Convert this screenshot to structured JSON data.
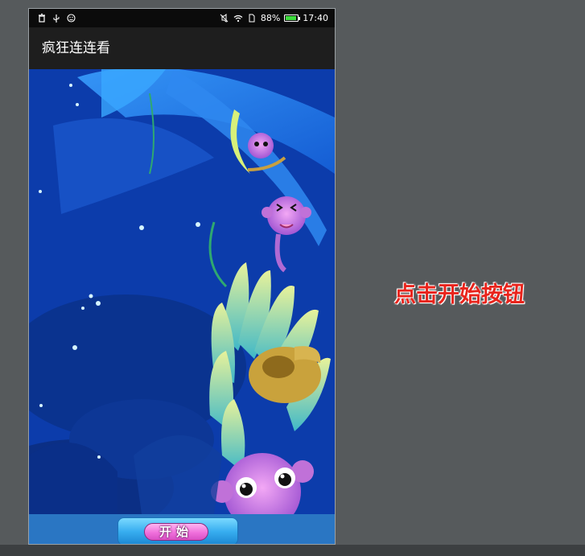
{
  "status_bar": {
    "left_icons": [
      "trash-icon",
      "usb-icon",
      "face-icon"
    ],
    "battery_percent": "88%",
    "time": "17:40",
    "battery_fill_fraction": 0.88
  },
  "app_bar": {
    "title": "疯狂连连看"
  },
  "footer": {
    "start_label": "开始"
  },
  "annotation": {
    "text": "点击开始按钮"
  },
  "colors": {
    "background": "#565a5c",
    "scene_blue": "#0b3aa0",
    "footer_blue": "#2a76c3",
    "annotation_red": "#e8241c",
    "button_pink": "#f070dc"
  }
}
